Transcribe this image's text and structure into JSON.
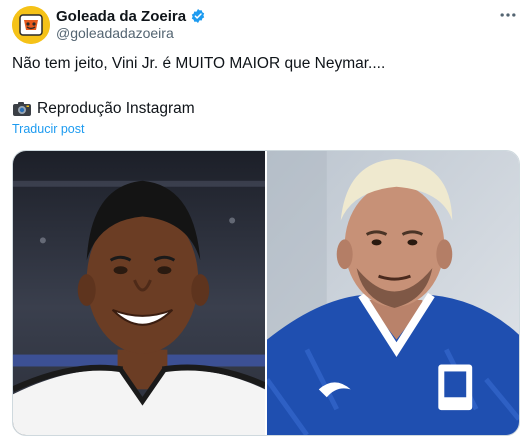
{
  "author": {
    "display_name": "Goleada da Zoeira",
    "handle": "@goleadadazoeira",
    "avatar_icon": "goleada-logo-icon",
    "verified_icon": "verified-badge-icon",
    "verified_color": "#1d9bf0"
  },
  "tweet": {
    "text": "Não tem jeito, Vini Jr. é MUITO MAIOR que Neymar....",
    "credit_text": "Reprodução Instagram",
    "credit_icon": "camera-emoji-icon",
    "translate_label": "Traducir post"
  },
  "media": {
    "photos": [
      {
        "subject": "smiling-player-icon",
        "bg": "#2b2f3a",
        "shirt": "#f4f4f4"
      },
      {
        "subject": "player-blue-kit-icon",
        "bg": "#cfd6df",
        "shirt": "#1f4fb0"
      }
    ]
  },
  "colors": {
    "text_primary": "#0f1419",
    "text_secondary": "#536471",
    "link": "#1d9bf0",
    "border": "#cfd9de"
  }
}
